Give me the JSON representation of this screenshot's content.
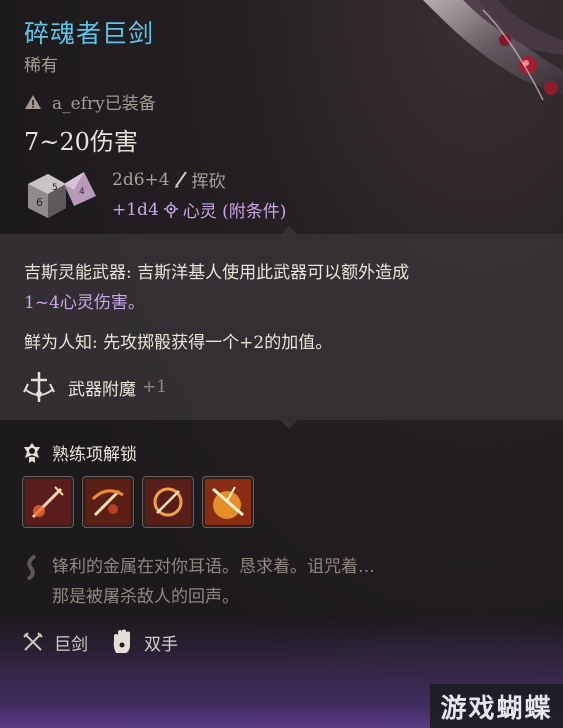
{
  "item": {
    "name": "碎魂者巨剑",
    "rarity": "稀有",
    "equipped_by": "a_efry已装备",
    "damage_total": "7~20伤害"
  },
  "damage": {
    "base_roll": "2d6+4",
    "base_type": "挥砍",
    "extra_roll": "+1d4",
    "extra_type": "心灵 (附条件)"
  },
  "passives": {
    "psionic_label": "吉斯灵能武器:",
    "psionic_text": " 吉斯洋基人使用此武器可以额外造成",
    "psionic_dmg": "1~4心灵伤害。",
    "rare_label": "鲜为人知:",
    "rare_text": " 先攻掷骰获得一个+2的加值。",
    "enchant_label": "武器附魔",
    "enchant_value": "+1"
  },
  "proficiency": {
    "title": "熟练项解锁",
    "actions": [
      "action-1",
      "action-2",
      "action-3",
      "action-4"
    ]
  },
  "flavor": {
    "line1": "锋利的金属在对你耳语。恳求着。诅咒着…",
    "line2": "那是被屠杀敌人的回声。"
  },
  "tags": {
    "weapon_type": "巨剑",
    "handedness": "双手"
  },
  "watermark": "游戏蝴蝶",
  "colors": {
    "title": "#5ec4e8",
    "psionic": "#c9a7e6"
  }
}
